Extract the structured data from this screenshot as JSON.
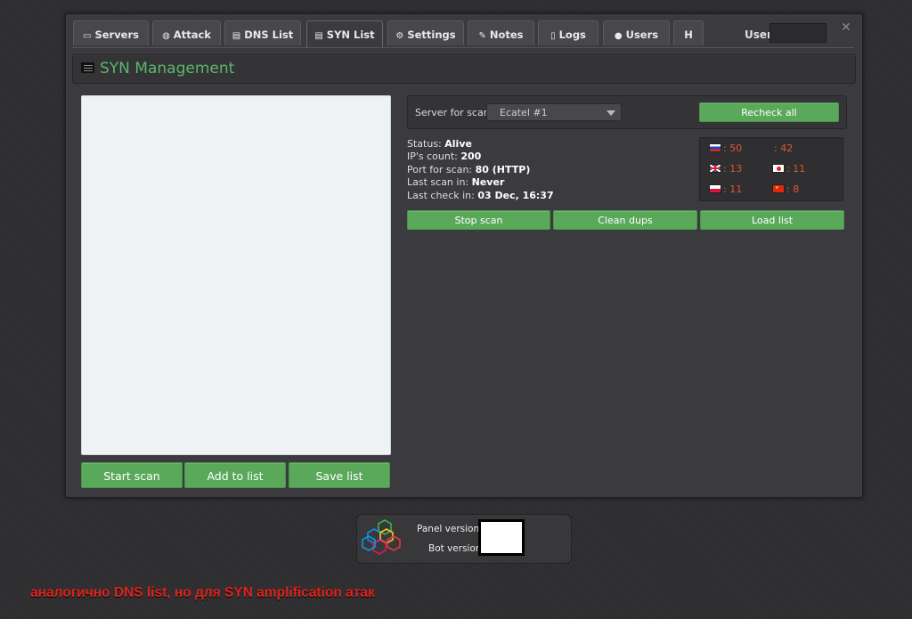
{
  "tabs": [
    {
      "label": "Servers",
      "icon": "server-icon",
      "glyph": "▭"
    },
    {
      "label": "Attack",
      "icon": "dashboard-icon",
      "glyph": "◍"
    },
    {
      "label": "DNS List",
      "icon": "list-icon",
      "glyph": "▤"
    },
    {
      "label": "SYN List",
      "icon": "list-icon",
      "glyph": "▤"
    },
    {
      "label": "Settings",
      "icon": "gears-icon",
      "glyph": "⚙"
    },
    {
      "label": "Notes",
      "icon": "edit-icon",
      "glyph": "✎"
    },
    {
      "label": "Logs",
      "icon": "document-icon",
      "glyph": "▯"
    },
    {
      "label": "Users",
      "icon": "user-icon",
      "glyph": "●"
    },
    {
      "label": "H",
      "icon": "",
      "glyph": ""
    }
  ],
  "active_tab": "SYN List",
  "header": {
    "user_label": "User:",
    "close_glyph": "✕"
  },
  "page_title": "SYN Management",
  "buttons": {
    "start_scan": "Start scan",
    "add_to_list": "Add to list",
    "save_list": "Save list",
    "recheck_all": "Recheck all",
    "stop_scan": "Stop scan",
    "clean_dups": "Clean dups",
    "load_list": "Load list"
  },
  "server": {
    "label": "Server for scan:",
    "selected": "Ecatel #1"
  },
  "status": {
    "status_label": "Status: ",
    "status_value": "Alive",
    "ips_label": "IP's count: ",
    "ips_value": "200",
    "port_label": "Port for scan: ",
    "port_value": "80 (HTTP)",
    "last_scan_label": "Last scan in: ",
    "last_scan_value": "Never",
    "last_check_label": "Last check in: ",
    "last_check_value": "03 Dec, 16:37"
  },
  "flag_counts": [
    {
      "country": "ru",
      "count": ": 50"
    },
    {
      "country": "unknown",
      "count": ": 42"
    },
    {
      "country": "gb",
      "count": ": 13"
    },
    {
      "country": "jp",
      "count": ": 11"
    },
    {
      "country": "pl",
      "count": ": 11"
    },
    {
      "country": "cn",
      "count": ": 8"
    }
  ],
  "footer": {
    "panel_version_label": "Panel version",
    "bot_version_label": "Bot version"
  },
  "note": "аналогично DNS list, но для SYN amplification атак",
  "colors": {
    "accent_green": "#5aa95b",
    "title_green": "#59b86a",
    "count_orange": "#e0552b",
    "note_red": "#e0221b"
  }
}
